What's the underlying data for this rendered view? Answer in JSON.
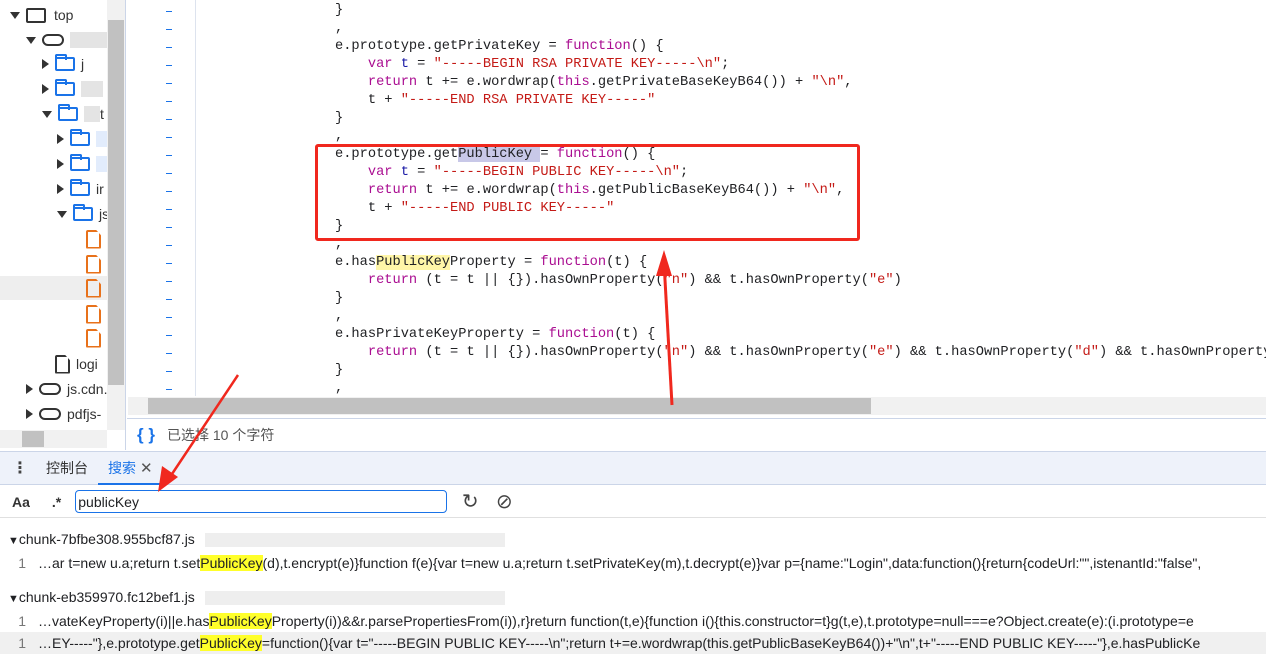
{
  "sidebar": {
    "top_label": "top",
    "folders": [
      "j",
      "",
      "t",
      "",
      "",
      "ir",
      "js"
    ],
    "file_login": "logi",
    "domain_cdn": "js.cdn.",
    "domain_pdfjs": "pdfjs-"
  },
  "editor": {
    "lines": [
      [
        [
          "p",
          "}"
        ]
      ],
      [
        [
          "p",
          ","
        ]
      ],
      [
        [
          "p",
          "e.prototype.getPrivateKey = "
        ],
        [
          "kw",
          "function"
        ],
        [
          "p",
          "() {"
        ]
      ],
      [
        [
          "p",
          "    "
        ],
        [
          "kw",
          "var"
        ],
        [
          "var",
          " t"
        ],
        [
          "p",
          " = "
        ],
        [
          "str",
          "\"-----BEGIN RSA PRIVATE KEY-----\\n\""
        ],
        [
          "p",
          ";"
        ]
      ],
      [
        [
          "p",
          "    "
        ],
        [
          "kw",
          "return"
        ],
        [
          "p",
          " t += e.wordwrap("
        ],
        [
          "kw",
          "this"
        ],
        [
          "p",
          ".getPrivateBaseKeyB64()) + "
        ],
        [
          "str",
          "\"\\n\""
        ],
        [
          "p",
          ","
        ]
      ],
      [
        [
          "p",
          "    t + "
        ],
        [
          "str",
          "\"-----END RSA PRIVATE KEY-----\""
        ]
      ],
      [
        [
          "p",
          "}"
        ]
      ],
      [
        [
          "p",
          ","
        ]
      ],
      [
        [
          "p",
          "e.prototype.get"
        ],
        [
          "sel",
          "PublicKey "
        ],
        [
          "p",
          "= "
        ],
        [
          "kw",
          "function"
        ],
        [
          "p",
          "() {"
        ]
      ],
      [
        [
          "p",
          "    "
        ],
        [
          "kw",
          "var"
        ],
        [
          "var",
          " t"
        ],
        [
          "p",
          " = "
        ],
        [
          "str",
          "\"-----BEGIN PUBLIC KEY-----\\n\""
        ],
        [
          "p",
          ";"
        ]
      ],
      [
        [
          "p",
          "    "
        ],
        [
          "kw",
          "return"
        ],
        [
          "p",
          " t += e.wordwrap("
        ],
        [
          "kw",
          "this"
        ],
        [
          "p",
          ".getPublicBaseKeyB64()) + "
        ],
        [
          "str",
          "\"\\n\""
        ],
        [
          "p",
          ","
        ]
      ],
      [
        [
          "p",
          "    t + "
        ],
        [
          "str",
          "\"-----END PUBLIC KEY-----\""
        ]
      ],
      [
        [
          "p",
          "}"
        ]
      ],
      [
        [
          "p",
          ","
        ]
      ],
      [
        [
          "p",
          "e.has"
        ],
        [
          "hl",
          "PublicKey"
        ],
        [
          "p",
          "Property = "
        ],
        [
          "kw",
          "function"
        ],
        [
          "p",
          "(t) {"
        ]
      ],
      [
        [
          "p",
          "    "
        ],
        [
          "kw",
          "return"
        ],
        [
          "p",
          " (t = t || {}).hasOwnProperty("
        ],
        [
          "str",
          "\"n\""
        ],
        [
          "p",
          ") && t.hasOwnProperty("
        ],
        [
          "str",
          "\"e\""
        ],
        [
          "p",
          ")"
        ]
      ],
      [
        [
          "p",
          "}"
        ]
      ],
      [
        [
          "p",
          ","
        ]
      ],
      [
        [
          "p",
          "e.hasPrivateKeyProperty = "
        ],
        [
          "kw",
          "function"
        ],
        [
          "p",
          "(t) {"
        ]
      ],
      [
        [
          "p",
          "    "
        ],
        [
          "kw",
          "return"
        ],
        [
          "p",
          " (t = t || {}).hasOwnProperty("
        ],
        [
          "str",
          "\"n\""
        ],
        [
          "p",
          ") && t.hasOwnProperty("
        ],
        [
          "str",
          "\"e\""
        ],
        [
          "p",
          ") && t.hasOwnProperty("
        ],
        [
          "str",
          "\"d\""
        ],
        [
          "p",
          ") && t.hasOwnProperty"
        ]
      ],
      [
        [
          "p",
          "}"
        ]
      ],
      [
        [
          "p",
          ","
        ]
      ]
    ]
  },
  "status": {
    "text": "已选择 10 个字符"
  },
  "drawer": {
    "tabs": [
      {
        "label": "控制台"
      },
      {
        "label": "搜索"
      }
    ],
    "case_option": "Aa",
    "regex_option": ".*",
    "search_value": "publicKey"
  },
  "results": [
    {
      "file": "chunk-7bfbe308.955bcf87.js",
      "matches": [
        {
          "line": "1",
          "before": "…ar t=new u.a;return t.set",
          "match": "PublicKey",
          "after": "(d),t.encrypt(e)}function f(e){var t=new u.a;return t.setPrivateKey(m),t.decrypt(e)}var p={name:\"Login\",data:function(){return{codeUrl:\"\",istenantId:\"false\","
        }
      ]
    },
    {
      "file": "chunk-eb359970.fc12bef1.js",
      "matches": [
        {
          "line": "1",
          "before": "…vateKeyProperty(i)||e.has",
          "match": "PublicKey",
          "after": "Property(i))&&r.parsePropertiesFrom(i)),r}return function(t,e){function i(){this.constructor=t}g(t,e),t.prototype=null===e?Object.create(e):(i.prototype=e"
        },
        {
          "line": "1",
          "before": "…EY-----\"},e.prototype.get",
          "match": "PublicKey",
          "after": "=function(){var t=\"-----BEGIN PUBLIC KEY-----\\n\";return t+=e.wordwrap(this.getPublicBaseKeyB64())+\"\\n\",t+\"-----END PUBLIC KEY-----\"},e.hasPublicKe"
        }
      ]
    }
  ],
  "colors": {
    "accent": "#1a73e8",
    "annotation": "#f0281e",
    "match_highlight": "#ffff2a",
    "keyword": "#aa0d91",
    "string": "#c41a16"
  }
}
